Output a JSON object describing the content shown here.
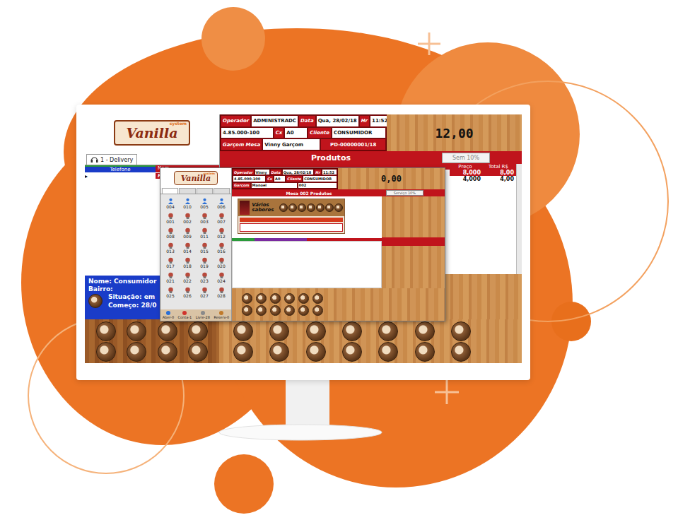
{
  "logo": {
    "name": "Vanilla",
    "tag": "system"
  },
  "header": {
    "rows": [
      [
        {
          "text": "Operador",
          "kind": "label"
        },
        {
          "text": "ADMINISTRADC",
          "kind": "value"
        },
        {
          "text": "Data",
          "kind": "label"
        },
        {
          "text": "Qua, 28/02/18",
          "kind": "value"
        },
        {
          "text": "Hr",
          "kind": "label"
        },
        {
          "text": "11:52",
          "kind": "value"
        }
      ],
      [
        {
          "text": "4.85.000-100",
          "kind": "value"
        },
        {
          "text": "Cx",
          "kind": "label"
        },
        {
          "text": "A0",
          "kind": "value"
        },
        {
          "text": "Cliente",
          "kind": "label"
        },
        {
          "text": "CONSUMIDOR",
          "kind": "value"
        }
      ],
      [
        {
          "text": "Garçom Mesa",
          "kind": "label"
        },
        {
          "text": "Vinny Garçom",
          "kind": "value"
        },
        {
          "text": "PD-00000001/18",
          "kind": "code"
        }
      ]
    ]
  },
  "total": "12,00",
  "products_bar": {
    "title": "Produtos",
    "service": "Sem 10%"
  },
  "delivery_tab": {
    "label": "1 - Delivery",
    "selected": true
  },
  "orders_table": {
    "columns": [
      "Telefone",
      "Nom"
    ],
    "rows": [
      {
        "marker": "▸",
        "cells": [
          "",
          "PD-00000"
        ],
        "selected": true
      }
    ]
  },
  "products_table": {
    "columns": [
      "Preço",
      "Total R$"
    ],
    "rows": [
      {
        "cells": [
          "8,000",
          "8,00"
        ],
        "selected": true
      },
      {
        "cells": [
          "4,000",
          "4,00"
        ],
        "selected": false
      }
    ]
  },
  "customer": {
    "name": "Nome: Consumidor",
    "district": "Bairro:",
    "status": "Situação: em",
    "start": "Começo: 28/0"
  },
  "tables_window": {
    "header": {
      "rows": [
        [
          {
            "text": "Operador",
            "kind": "label"
          },
          {
            "text": "Vinny",
            "kind": "value"
          },
          {
            "text": "Data",
            "kind": "label"
          },
          {
            "text": "Qua, 28/02/18",
            "kind": "value"
          },
          {
            "text": "Hr",
            "kind": "label"
          },
          {
            "text": "11:52",
            "kind": "value"
          }
        ],
        [
          {
            "text": "4.85.000-100",
            "kind": "value"
          },
          {
            "text": "Cx",
            "kind": "label"
          },
          {
            "text": "A0",
            "kind": "value"
          },
          {
            "text": "Cliente",
            "kind": "label"
          },
          {
            "text": "CONSUMIDOR",
            "kind": "value"
          }
        ],
        [
          {
            "text": "Garçom",
            "kind": "label"
          },
          {
            "text": "Manoel",
            "kind": "value"
          },
          {
            "text": "002",
            "kind": "value"
          }
        ]
      ]
    },
    "total": "0,00",
    "bar": {
      "title": "Mesa 002 Produtos",
      "service": "Serviço 10%"
    },
    "dialog": {
      "title": "Vários sabores"
    },
    "tables": [
      {
        "number": "004",
        "occupied": true
      },
      {
        "number": "010",
        "occupied": true
      },
      {
        "number": "005",
        "occupied": true
      },
      {
        "number": "006",
        "occupied": true
      },
      {
        "number": "001",
        "occupied": false
      },
      {
        "number": "002",
        "occupied": false
      },
      {
        "number": "003",
        "occupied": false
      },
      {
        "number": "007",
        "occupied": false
      },
      {
        "number": "008",
        "occupied": false
      },
      {
        "number": "009",
        "occupied": false
      },
      {
        "number": "011",
        "occupied": false
      },
      {
        "number": "012",
        "occupied": false
      },
      {
        "number": "013",
        "occupied": false
      },
      {
        "number": "014",
        "occupied": false
      },
      {
        "number": "015",
        "occupied": false
      },
      {
        "number": "016",
        "occupied": false
      },
      {
        "number": "017",
        "occupied": false
      },
      {
        "number": "018",
        "occupied": false
      },
      {
        "number": "019",
        "occupied": false
      },
      {
        "number": "020",
        "occupied": false
      },
      {
        "number": "021",
        "occupied": false
      },
      {
        "number": "022",
        "occupied": false
      },
      {
        "number": "023",
        "occupied": false
      },
      {
        "number": "024",
        "occupied": false
      },
      {
        "number": "025",
        "occupied": false
      },
      {
        "number": "026",
        "occupied": false
      },
      {
        "number": "027",
        "occupied": false
      },
      {
        "number": "028",
        "occupied": false
      }
    ],
    "legend": [
      {
        "label": "Aber-0",
        "color": "#2a6fd6"
      },
      {
        "label": "Conta-1",
        "color": "#d0342c"
      },
      {
        "label": "Livre-28",
        "color": "#8a8a8a"
      },
      {
        "label": "Reserv-0",
        "color": "#c07a2a"
      }
    ]
  }
}
